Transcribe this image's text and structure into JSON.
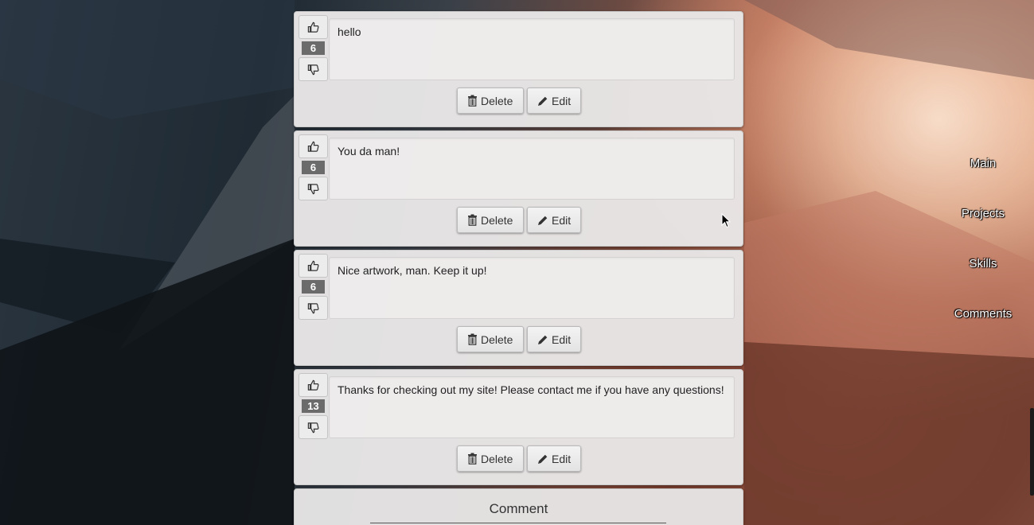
{
  "nav": {
    "items": [
      {
        "label": "Main"
      },
      {
        "label": "Projects"
      },
      {
        "label": "Skills"
      },
      {
        "label": "Comments"
      }
    ]
  },
  "comments": [
    {
      "text": "hello",
      "votes": "6"
    },
    {
      "text": "You da man!",
      "votes": "6"
    },
    {
      "text": "Nice artwork, man. Keep it up!",
      "votes": "6"
    },
    {
      "text": "Thanks for checking out my site! Please contact me if you have any questions!",
      "votes": "13"
    }
  ],
  "actions": {
    "delete_label": "Delete",
    "edit_label": "Edit"
  },
  "comment_section": {
    "title": "Comment"
  },
  "colors": {
    "vote_badge": "#6b6b6b",
    "card_bg": "#e8e6e6",
    "nav_text": "#ffffff"
  }
}
